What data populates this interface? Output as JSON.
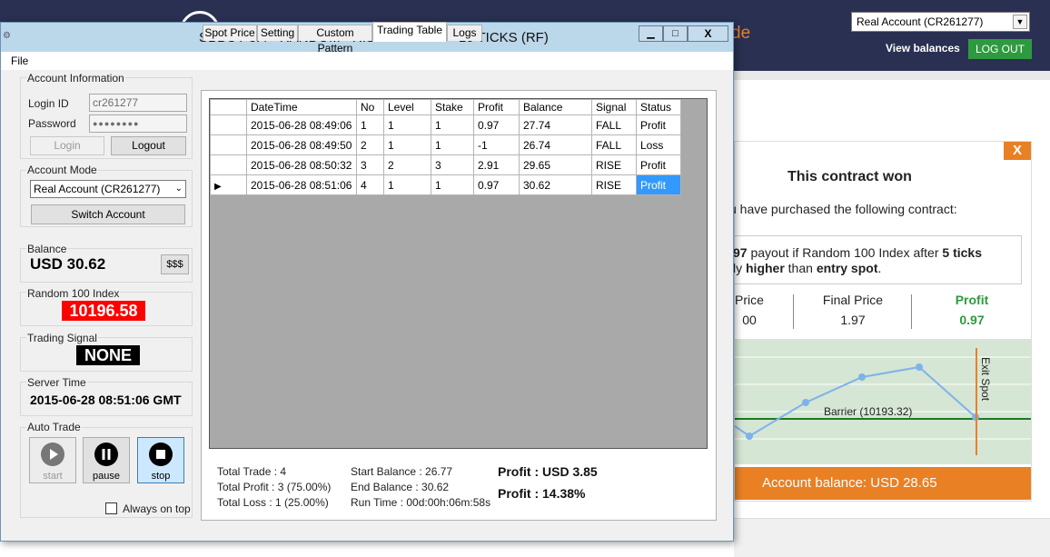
{
  "website": {
    "account_select": "Real Account (CR261277)",
    "view_balances": "View balances",
    "logout": "LOG OUT",
    "logo_fragment": "de",
    "modal": {
      "close": "X",
      "title": "This contract won",
      "intro": "u have purchased the following contract:",
      "line1_prefix": "97",
      "line1_mid": " payout if Random 100 Index after ",
      "line1_ticks": "5 ticks",
      "line2_pre": "ly ",
      "line2_bold1": "higher",
      "line2_mid": " than ",
      "line2_bold2": "entry spot",
      "line2_end": ".",
      "col1_label": "Price",
      "col1_value": "00",
      "col2_label": "Final Price",
      "col2_value": "1.97",
      "col3_label": "Profit",
      "col3_value": "0.97",
      "chart": {
        "barrier_label": "Barrier (10193.32)",
        "exit_label": "Exit Spot"
      },
      "account_balance": "Account balance: USD 28.65"
    }
  },
  "window": {
    "title": "SBBOT 3.4 - RANDOM - RISE or FALL 5 - 10 TICKS (RF)",
    "min": "▁",
    "max": "□",
    "close": "X",
    "menu": {
      "file": "File"
    }
  },
  "account_info": {
    "label": "Account Information",
    "login_id_label": "Login ID",
    "login_id_value": "cr261277",
    "password_label": "Password",
    "password_value": "●●●●●●●●",
    "login_button": "Login",
    "logout_button": "Logout"
  },
  "account_mode": {
    "label": "Account Mode",
    "selected": "Real Account (CR261277)",
    "switch_button": "Switch Account"
  },
  "balance": {
    "label": "Balance",
    "value": "USD 30.62",
    "button": "$$$"
  },
  "index": {
    "label": "Random 100 Index",
    "value": "10196.58"
  },
  "signal": {
    "label": "Trading Signal",
    "value": "NONE"
  },
  "server_time": {
    "label": "Server Time",
    "value": "2015-06-28 08:51:06 GMT"
  },
  "auto_trade": {
    "label": "Auto Trade",
    "start": "start",
    "pause": "pause",
    "stop": "stop",
    "always_on_top": "Always on top"
  },
  "tabs": [
    "Spot Price",
    "Setting",
    "Custom Pattern",
    "Trading Table",
    "Logs"
  ],
  "table": {
    "columns": [
      "DateTime",
      "No",
      "Level",
      "Stake",
      "Profit",
      "Balance",
      "Signal",
      "Status"
    ],
    "rows": [
      [
        "2015-06-28 08:49:06",
        "1",
        "1",
        "1",
        "0.97",
        "27.74",
        "FALL",
        "Profit"
      ],
      [
        "2015-06-28 08:49:50",
        "2",
        "1",
        "1",
        "-1",
        "26.74",
        "FALL",
        "Loss"
      ],
      [
        "2015-06-28 08:50:32",
        "3",
        "2",
        "3",
        "2.91",
        "29.65",
        "RISE",
        "Profit"
      ],
      [
        "2015-06-28 08:51:06",
        "4",
        "1",
        "1",
        "0.97",
        "30.62",
        "RISE",
        "Profit"
      ]
    ]
  },
  "stats": {
    "total_trade": "Total Trade : 4",
    "total_profit": "Total Profit : 3 (75.00%)",
    "total_loss": "Total Loss : 1 (25.00%)",
    "start_balance": "Start Balance : 26.77",
    "end_balance": "End Balance : 30.62",
    "run_time": "Run Time : 00d:00h:06m:58s",
    "profit_usd": "Profit : USD 3.85",
    "profit_pct": "Profit : 14.38%"
  },
  "colors": {
    "index_bg": "#ff0000",
    "signal_bg": "#000000",
    "selection": "#3399ff",
    "accent_orange": "#e98024",
    "header_navy": "#2a3052",
    "logout_green": "#2e9a3f"
  }
}
